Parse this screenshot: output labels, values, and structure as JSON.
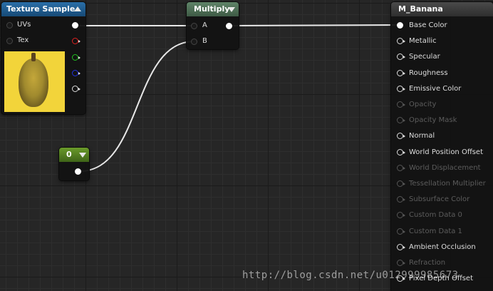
{
  "texture_sample": {
    "title": "Texture Sample",
    "inputs": [
      "UVs",
      "Tex"
    ],
    "header_color": "#1e5a8c",
    "output_colors": [
      "#ffffff",
      "#e02020",
      "#20c020",
      "#2030e0",
      "#cccccc"
    ],
    "preview_color": "#f2d43a"
  },
  "multiply": {
    "title": "Multiply",
    "inputs": [
      "A",
      "B"
    ],
    "header_color": "#4e6e56"
  },
  "constant": {
    "title": "0",
    "header_color": "#57841f"
  },
  "material": {
    "title": "M_Banana",
    "header_color": "#3a3a3a",
    "pins": [
      {
        "label": "Base Color",
        "enabled": true
      },
      {
        "label": "Metallic",
        "enabled": true
      },
      {
        "label": "Specular",
        "enabled": true
      },
      {
        "label": "Roughness",
        "enabled": true
      },
      {
        "label": "Emissive Color",
        "enabled": true
      },
      {
        "label": "Opacity",
        "enabled": false
      },
      {
        "label": "Opacity Mask",
        "enabled": false
      },
      {
        "label": "Normal",
        "enabled": true
      },
      {
        "label": "World Position Offset",
        "enabled": true
      },
      {
        "label": "World Displacement",
        "enabled": false
      },
      {
        "label": "Tessellation Multiplier",
        "enabled": false
      },
      {
        "label": "Subsurface Color",
        "enabled": false
      },
      {
        "label": "Custom Data 0",
        "enabled": false
      },
      {
        "label": "Custom Data 1",
        "enabled": false
      },
      {
        "label": "Ambient Occlusion",
        "enabled": true
      },
      {
        "label": "Refraction",
        "enabled": false
      },
      {
        "label": "Pixel Depth Offset",
        "enabled": true
      }
    ]
  },
  "watermark": "http://blog.csdn.net/u012999985673"
}
